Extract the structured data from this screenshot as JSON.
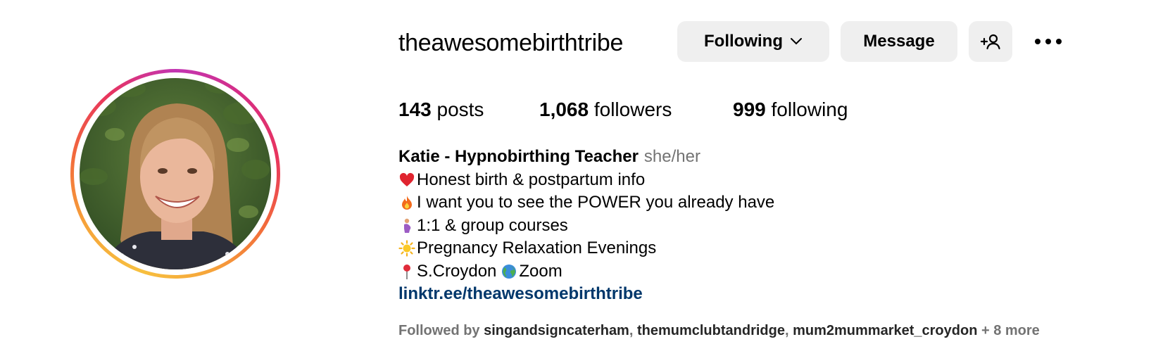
{
  "profile": {
    "username": "theawesomebirthtribe",
    "avatar_icon": "profile-photo"
  },
  "actions": {
    "following_label": "Following",
    "message_label": "Message",
    "add_user_icon": "add-user-icon",
    "more_icon": "more-options-icon"
  },
  "stats": {
    "posts_count": "143",
    "posts_label": "posts",
    "followers_count": "1,068",
    "followers_label": "followers",
    "following_count": "999",
    "following_label": "following"
  },
  "bio": {
    "name": "Katie - Hypnobirthing Teacher",
    "pronouns": "she/her",
    "lines": [
      {
        "icon": "heart-icon",
        "text": "Honest birth & postpartum info"
      },
      {
        "icon": "fire-icon",
        "text": "I want you to see the POWER you already have"
      },
      {
        "icon": "pregnant-woman-icon",
        "text": "1:1 & group courses"
      },
      {
        "icon": "sun-icon",
        "text": "Pregnancy Relaxation Evenings"
      },
      {
        "icon": "pin-icon",
        "text": "S.Croydon ",
        "icon2": "globe-icon",
        "text2": " Zoom"
      }
    ],
    "link": "linktr.ee/theawesomebirthtribe"
  },
  "followed_by": {
    "prefix": "Followed by ",
    "accounts": [
      "singandsigncaterham",
      "themumclubtandridge",
      "mum2mummarket_croydon"
    ],
    "separator": ", ",
    "more": " + 8 more"
  },
  "colors": {
    "button_bg": "#efefef",
    "link": "#00376b",
    "muted": "#737373"
  }
}
